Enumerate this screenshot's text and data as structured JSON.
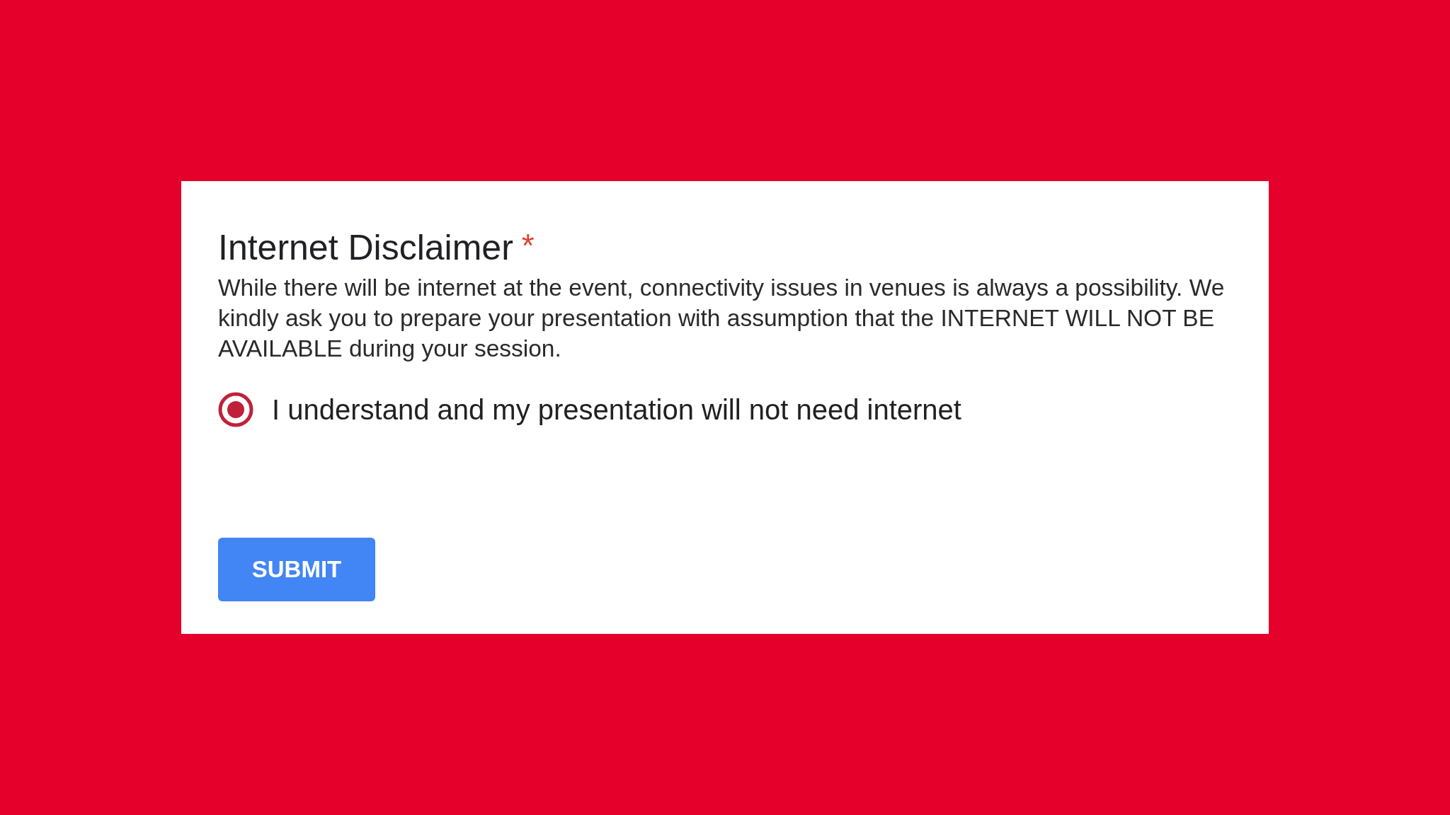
{
  "question": {
    "title": "Internet Disclaimer",
    "required_mark": "*",
    "description": "While there will be internet at the event, connectivity issues in venues is always a possibility. We kindly ask you to prepare your presentation with assumption that the INTERNET WILL NOT BE AVAILABLE during your session.",
    "options": [
      {
        "label": "I understand and my presentation will not need internet",
        "selected": true
      }
    ]
  },
  "buttons": [
    {
      "label": "SUBMIT"
    }
  ]
}
